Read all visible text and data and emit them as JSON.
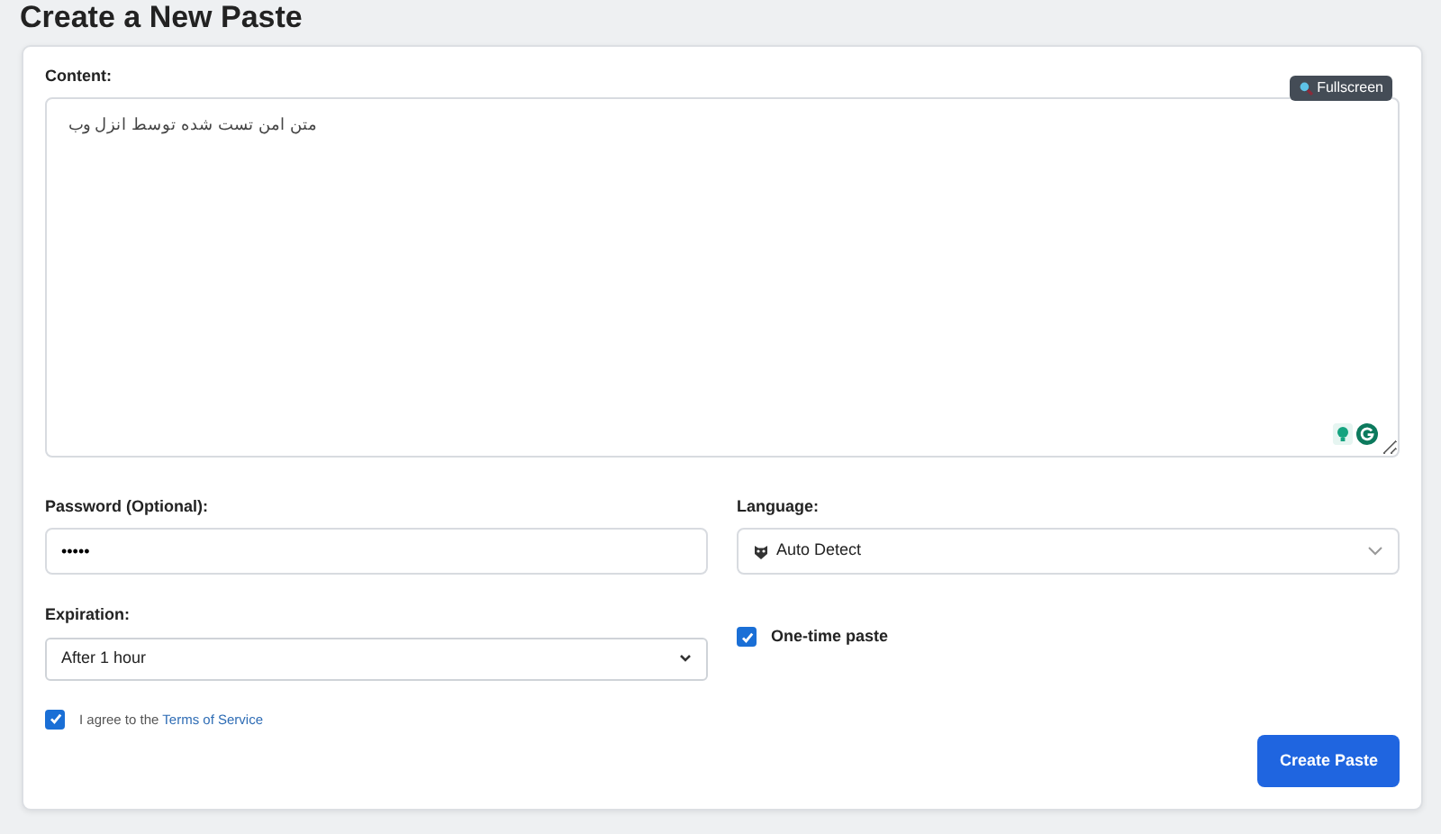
{
  "page_title": "Create a New Paste",
  "content": {
    "label": "Content:",
    "fullscreen_button": "Fullscreen",
    "value": "متن امن تست شده توسط انزل وب"
  },
  "password": {
    "label": "Password (Optional):",
    "value": "•••••"
  },
  "language": {
    "label": "Language:",
    "value": "Auto Detect"
  },
  "expiration": {
    "label": "Expiration:",
    "value": "After 1 hour"
  },
  "one_time": {
    "label": "One-time paste",
    "checked": true
  },
  "agree": {
    "text": "I agree to the",
    "link": "Terms of Service",
    "checked": true
  },
  "submit_button": "Create Paste"
}
